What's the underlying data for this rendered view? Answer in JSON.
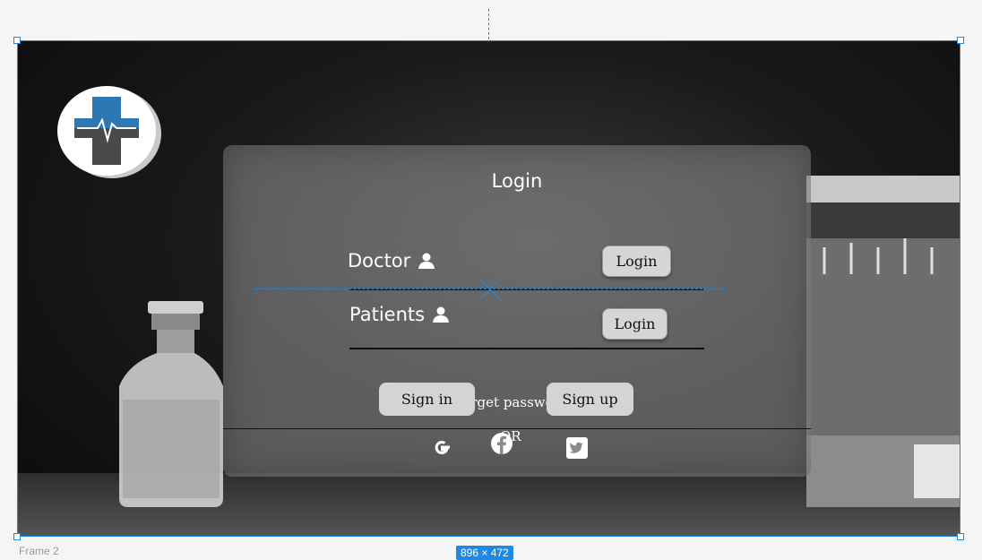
{
  "panel": {
    "title": "Login",
    "doctor_label": "Doctor",
    "patients_label": "Patients",
    "doctor_login_button": "Login",
    "patients_login_button": "Login",
    "forget_password": "Forget password ?",
    "sign_in_button": "Sign in",
    "or_text": "OR",
    "sign_up_button": "Sign up",
    "social_icons": [
      "google-icon",
      "facebook-icon",
      "twitter-icon"
    ]
  },
  "canvas": {
    "frame_label": "Frame 2",
    "size_badge": "896 × 472"
  },
  "colors": {
    "accent": "#1e88e5",
    "logo_blue": "#2b78b3",
    "logo_gray": "#4a4a4a",
    "button_bg": "#d6d6d6"
  },
  "icons": [
    "user-icon",
    "medical-cross-logo"
  ]
}
